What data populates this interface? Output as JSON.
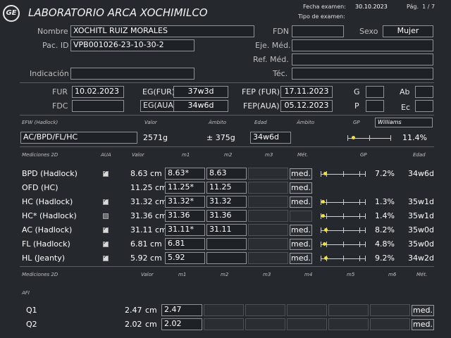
{
  "header": {
    "lab_name": "LABORATORIO ARCA XOCHIMILCO",
    "exam_date_label": "Fecha examen:",
    "exam_date": "30.10.2023",
    "exam_type_label": "Tipo de examen:",
    "page": "Pág.  1 / 7",
    "logo_text": "GE"
  },
  "patient": {
    "name_label": "Nombre",
    "name": "XOCHITL RUIZ MORALES",
    "id_label": "Pac. ID",
    "id": "VPB001026-23-10-30-2",
    "indication_label": "Indicación",
    "fdn_label": "FDN",
    "sex_label": "Sexo",
    "sex": "Mujer",
    "eje_label": "Eje. Méd.",
    "ref_label": "Ref. Méd.",
    "tec_label": "Téc."
  },
  "obstetric": {
    "fur_label": "FUR",
    "fur": "10.02.2023",
    "fdc_label": "FDC",
    "eg_fur_label": "EG(FUR)",
    "eg_fur": "37w3d",
    "eg_aua_label": "EG(AUA)",
    "eg_aua": "34w6d",
    "fep_fur_label": "FEP (FUR)",
    "fep_fur": "17.11.2023",
    "fep_aua_label": "FEP(AUA)",
    "fep_aua": "05.12.2023",
    "g_label": "G",
    "p_label": "P",
    "ab_label": "Ab",
    "ec_label": "Ec"
  },
  "efw": {
    "h_efw": "EFW (Hadlock)",
    "h_valor": "Valor",
    "h_ambito": "Ámbito",
    "h_edad": "Edad",
    "h_ambito2": "Ámbito",
    "h_gp": "GP",
    "method": "Williams",
    "formula": "AC/BPD/FL/HC",
    "value": "2571g",
    "range": "± 375g",
    "age": "34w6d",
    "percentile": "11.4%",
    "percentile_fraction": 0.114
  },
  "m2d": {
    "headers": {
      "title": "Mediciones 2D",
      "aua": "AUA",
      "valor": "Valor",
      "m1": "m1",
      "m2": "m2",
      "m3": "m3",
      "met": "Mét.",
      "gp": "GP",
      "edad": "Edad"
    },
    "rows": [
      {
        "name": "BPD (Hadlock)",
        "aua": "on",
        "value": "8.63 cm",
        "m1": "8.63*",
        "m2": "8.63",
        "med": "med.",
        "gp": "7.2%",
        "gp_frac": 0.072,
        "age": "34w6d"
      },
      {
        "name": "OFD (HC)",
        "aua": "",
        "value": "11.25 cm",
        "m1": "11.25*",
        "m2": "11.25",
        "med": "med.",
        "gp": "",
        "gp_frac": null,
        "age": ""
      },
      {
        "name": "HC (Hadlock)",
        "aua": "on",
        "value": "31.32 cm",
        "m1": "31.32*",
        "m2": "31.32",
        "med": "med.",
        "gp": "1.3%",
        "gp_frac": 0.013,
        "age": "35w1d"
      },
      {
        "name": "HC* (Hadlock)",
        "aua": "off",
        "value": "31.36 cm",
        "m1": "31.36",
        "m2": "31.36",
        "med": "",
        "gp": "1.4%",
        "gp_frac": 0.014,
        "age": "35w1d"
      },
      {
        "name": "AC (Hadlock)",
        "aua": "on",
        "value": "31.11 cm",
        "m1": "31.11*",
        "m2": "31.11",
        "med": "med.",
        "gp": "8.2%",
        "gp_frac": 0.082,
        "age": "35w0d"
      },
      {
        "name": "FL (Hadlock)",
        "aua": "on",
        "value": "6.81 cm",
        "m1": "6.81",
        "m2": "",
        "med": "med.",
        "gp": "4.8%",
        "gp_frac": 0.048,
        "age": "35w0d"
      },
      {
        "name": "HL (Jeanty)",
        "aua": "on",
        "value": "5.92 cm",
        "m1": "5.92",
        "m2": "",
        "med": "med.",
        "gp": "9.2%",
        "gp_frac": 0.092,
        "age": "34w2d"
      }
    ]
  },
  "afi": {
    "headers": {
      "title": "Mediciones 2D",
      "valor": "Valor",
      "m1": "m1",
      "m2": "m2",
      "m3": "m3",
      "m4": "m4",
      "m5": "m5",
      "m6": "m6",
      "met": "Mét."
    },
    "section": "AFI",
    "rows": [
      {
        "name": "Q1",
        "value": "2.47",
        "unit": "cm",
        "m1": "2.47",
        "med": "med."
      },
      {
        "name": "Q2",
        "value": "2.02",
        "unit": "cm",
        "m1": "2.02",
        "med": "med."
      }
    ]
  }
}
